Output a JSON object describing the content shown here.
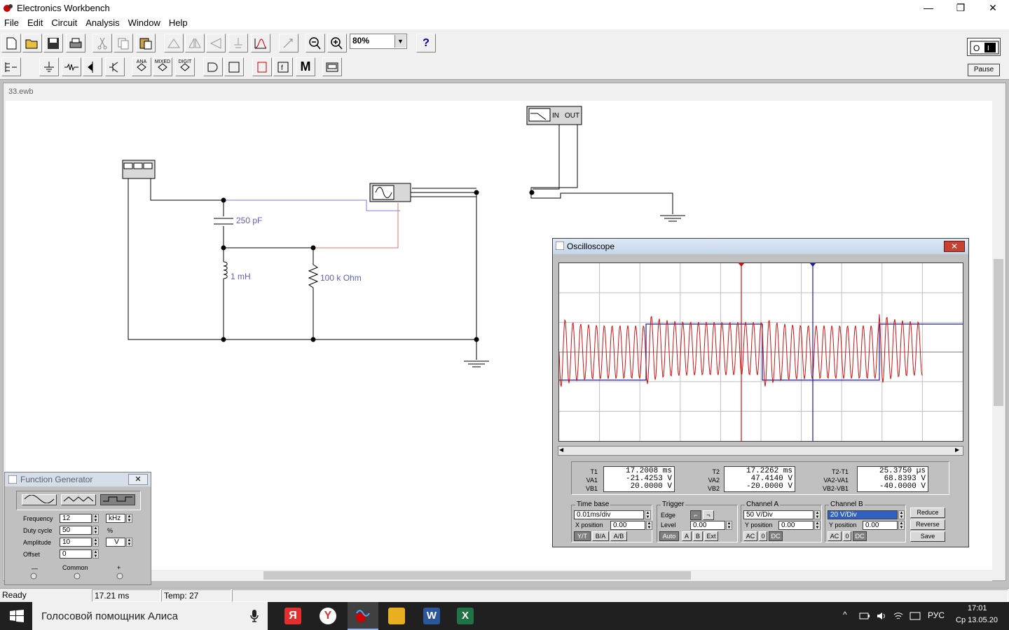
{
  "window": {
    "title": "Electronics Workbench",
    "minimize": "—",
    "maximize": "❐",
    "close": "✕"
  },
  "menu": [
    "File",
    "Edit",
    "Circuit",
    "Analysis",
    "Window",
    "Help"
  ],
  "toolbar": {
    "zoom": "80%",
    "help": "?",
    "parts_labels": {
      "ana": "ANA",
      "mixed": "MIXED",
      "digit": "DIGIT",
      "meter": "M"
    },
    "pause_label": "Pause"
  },
  "document": {
    "title": "33.ewb"
  },
  "circuit": {
    "capacitor_label": "250 pF",
    "inductor_label": "1 mH",
    "resistor_label": "100 k Ohm",
    "bode_in": "IN",
    "bode_out": "OUT"
  },
  "oscilloscope": {
    "title": "Oscilloscope",
    "readouts": {
      "t1_labels": [
        "T1",
        "VA1",
        "VB1"
      ],
      "t1_values": [
        "17.2008 ms",
        "-21.4253  V",
        "20.0000  V"
      ],
      "t2_labels": [
        "T2",
        "VA2",
        "VB2"
      ],
      "t2_values": [
        "17.2262 ms",
        "47.4140  V",
        "-20.0000  V"
      ],
      "diff_labels": [
        "T2-T1",
        "VA2-VA1",
        "VB2-VB1"
      ],
      "diff_values": [
        "25.3750 µs",
        "68.8393  V",
        "-40.0000  V"
      ]
    },
    "timebase": {
      "title": "Time base",
      "value": "0.01ms/div",
      "xpos_label": "X position",
      "xpos": "0.00",
      "modes": [
        "Y/T",
        "B/A",
        "A/B"
      ]
    },
    "trigger": {
      "title": "Trigger",
      "edge_label": "Edge",
      "level_label": "Level",
      "level": "0.00",
      "sources": [
        "Auto",
        "A",
        "B",
        "Ext"
      ]
    },
    "channel_a": {
      "title": "Channel A",
      "value": "50 V/Div",
      "ypos_label": "Y position",
      "ypos": "0.00",
      "coupling": [
        "AC",
        "0",
        "DC"
      ]
    },
    "channel_b": {
      "title": "Channel B",
      "value": "20 V/Div",
      "ypos_label": "Y position",
      "ypos": "0.00",
      "coupling": [
        "AC",
        "0",
        "DC"
      ]
    },
    "buttons": [
      "Reduce",
      "Reverse",
      "Save"
    ],
    "cursor1": "1",
    "cursor2": "2"
  },
  "function_generator": {
    "title": "Function Generator",
    "rows": [
      {
        "label": "Frequency",
        "value": "12",
        "unit": "kHz"
      },
      {
        "label": "Duty cycle",
        "value": "50",
        "unit": "%"
      },
      {
        "label": "Amplitude",
        "value": "10",
        "unit": "V"
      },
      {
        "label": "Offset",
        "value": "0",
        "unit": ""
      }
    ],
    "terminals": [
      "—",
      "Common",
      "+"
    ]
  },
  "status": {
    "state": "Ready",
    "time": "17.21 ms",
    "temp": "Temp:  27"
  },
  "taskbar": {
    "search": "Голосовой помощник Алиса",
    "lang": "РУС",
    "time": "17:01",
    "date": "Ср 13.05.20"
  },
  "colors": {
    "trace_a": "#d01010",
    "trace_b": "#1a1aa8",
    "wire_blue": "#7a7ae0",
    "wire_red": "#e07070",
    "label": "#6060c0"
  }
}
